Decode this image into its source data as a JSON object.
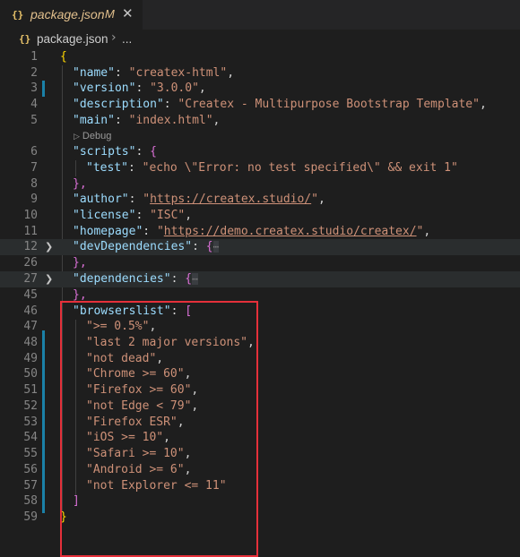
{
  "tab": {
    "icon_text": "{}",
    "filename": "package.json",
    "modified": "M",
    "close": "✕"
  },
  "breadcrumb": {
    "icon_text": "{}",
    "file": "package.json",
    "separator": "›",
    "more": "..."
  },
  "codelens": {
    "label": "Debug"
  },
  "lines": [
    {
      "n": "1",
      "code": "{"
    },
    {
      "n": "2",
      "key": "\"name\"",
      "val": "\"createx-html\""
    },
    {
      "n": "3",
      "key": "\"version\"",
      "val": "\"3.0.0\""
    },
    {
      "n": "4",
      "key": "\"description\"",
      "val": "\"Createx - Multipurpose Bootstrap Template\""
    },
    {
      "n": "5",
      "key": "\"main\"",
      "val": "\"index.html\""
    },
    {
      "n": "6",
      "key": "\"scripts\"",
      "val": "{"
    },
    {
      "n": "7",
      "key": "\"test\"",
      "val": "\"echo \\\"Error: no test specified\\\" && exit 1\""
    },
    {
      "n": "8",
      "code": "},"
    },
    {
      "n": "9",
      "key": "\"author\"",
      "val_pre": "\"",
      "val_url": "https://createx.studio/",
      "val_post": "\""
    },
    {
      "n": "10",
      "key": "\"license\"",
      "val": "\"ISC\""
    },
    {
      "n": "11",
      "key": "\"homepage\"",
      "val_pre": "\"",
      "val_url": "https://demo.createx.studio/createx/",
      "val_post": "\""
    },
    {
      "n": "12",
      "key": "\"devDependencies\"",
      "val": "{",
      "ellipsis": "⋯"
    },
    {
      "n": "26",
      "code": "},"
    },
    {
      "n": "27",
      "key": "\"dependencies\"",
      "val": "{",
      "ellipsis": "⋯"
    },
    {
      "n": "45",
      "code": "},"
    },
    {
      "n": "46",
      "key": "\"browserslist\"",
      "val": "["
    },
    {
      "n": "47",
      "val": "\">= 0.5%\""
    },
    {
      "n": "48",
      "val": "\"last 2 major versions\""
    },
    {
      "n": "49",
      "val": "\"not dead\""
    },
    {
      "n": "50",
      "val": "\"Chrome >= 60\""
    },
    {
      "n": "51",
      "val": "\"Firefox >= 60\""
    },
    {
      "n": "52",
      "val": "\"not Edge < 79\""
    },
    {
      "n": "53",
      "val": "\"Firefox ESR\""
    },
    {
      "n": "54",
      "val": "\"iOS >= 10\""
    },
    {
      "n": "55",
      "val": "\"Safari >= 10\""
    },
    {
      "n": "56",
      "val": "\"Android >= 6\""
    },
    {
      "n": "57",
      "val": "\"not Explorer <= 11\""
    },
    {
      "n": "58",
      "code": "]"
    },
    {
      "n": "59",
      "code": "}"
    }
  ],
  "colors": {
    "highlight_box": "#e5303a",
    "modified_bar": "#1b81a8"
  }
}
